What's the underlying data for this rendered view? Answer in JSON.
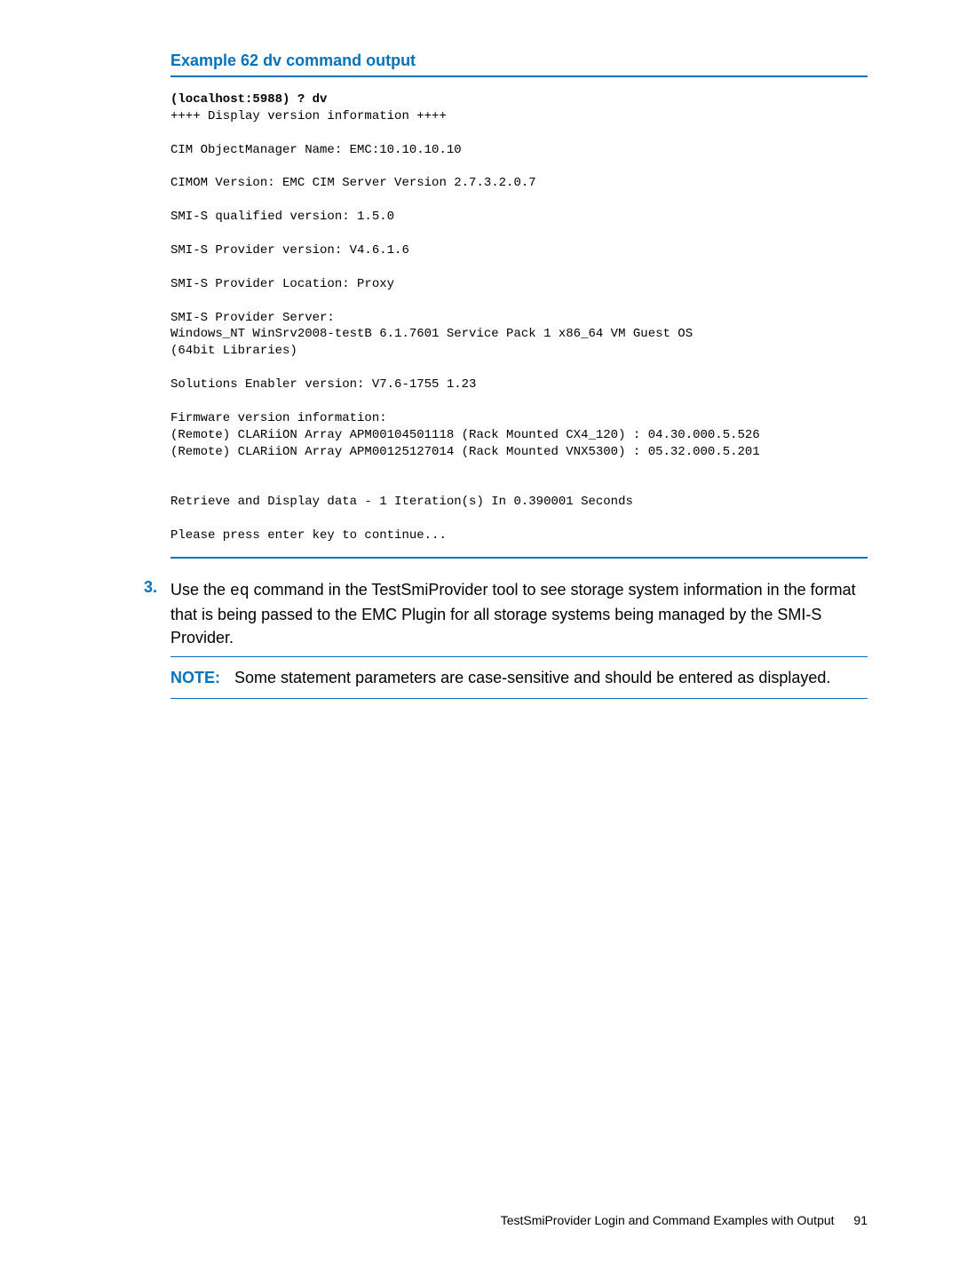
{
  "example": {
    "title": "Example 62 dv command output",
    "prompt": "(localhost:5988) ? dv",
    "lines": [
      "++++ Display version information ++++",
      "",
      "CIM ObjectManager Name: EMC:10.10.10.10",
      "",
      "CIMOM Version: EMC CIM Server Version 2.7.3.2.0.7",
      "",
      "SMI-S qualified version: 1.5.0",
      "",
      "SMI-S Provider version: V4.6.1.6",
      "",
      "SMI-S Provider Location: Proxy",
      "",
      "SMI-S Provider Server:",
      "Windows_NT WinSrv2008-testB 6.1.7601 Service Pack 1 x86_64 VM Guest OS",
      "(64bit Libraries)",
      "",
      "Solutions Enabler version: V7.6-1755 1.23",
      "",
      "Firmware version information:",
      "(Remote) CLARiiON Array APM00104501118 (Rack Mounted CX4_120) : 04.30.000.5.526",
      "(Remote) CLARiiON Array APM00125127014 (Rack Mounted VNX5300) : 05.32.000.5.201",
      "",
      "",
      "Retrieve and Display data - 1 Iteration(s) In 0.390001 Seconds",
      "",
      "Please press enter key to continue..."
    ]
  },
  "step": {
    "number": "3.",
    "text_before": "Use the ",
    "code": "eq",
    "text_after": " command in the TestSmiProvider tool to see storage system information in the format that is being passed to the EMC Plugin for all storage systems being managed by the SMI-S Provider."
  },
  "note": {
    "label": "NOTE:",
    "text": "Some statement parameters are case-sensitive and should be entered as displayed."
  },
  "footer": {
    "text": "TestSmiProvider Login and Command Examples with Output",
    "page": "91"
  }
}
